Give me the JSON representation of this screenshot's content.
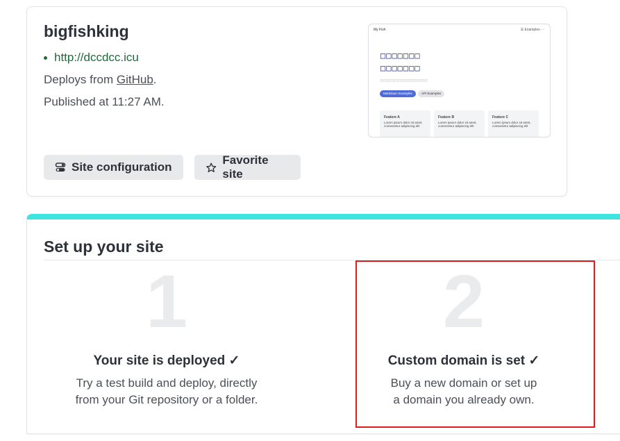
{
  "site": {
    "name": "bigfishking",
    "url": "http://dccdcc.icu",
    "deploys_prefix": "Deploys from ",
    "deploys_link": "GitHub",
    "deploys_suffix": ".",
    "published": "Published at 11:27 AM.",
    "config_button": "Site configuration",
    "favorite_button": "Favorite site"
  },
  "preview": {
    "brand": "My Fish",
    "nav_right": "☰   Examples   ⋯",
    "heading_line1": "□□□□□□□",
    "heading_line2": "□□□□□□□",
    "subtitle": "□□□□□□□□□□□□□□□□□",
    "btn_primary": "Markdown Examples",
    "btn_secondary": "API Examples",
    "features": [
      {
        "title": "Feature A",
        "text": "Lorem ipsum dolor sit amet, consectetur adipiscing elit"
      },
      {
        "title": "Feature B",
        "text": "Lorem ipsum dolor sit amet, consectetur adipiscing elit"
      },
      {
        "title": "Feature C",
        "text": "Lorem ipsum dolor sit amet, consectetur adipiscing elit"
      }
    ]
  },
  "setup": {
    "title": "Set up your site",
    "steps": [
      {
        "number": "1",
        "title": "Your site is deployed ✓",
        "desc_line1": "Try a test build and deploy, directly",
        "desc_line2": "from your Git repository or a folder."
      },
      {
        "number": "2",
        "title": "Custom domain is set ✓",
        "desc_line1": "Buy a new domain or set up",
        "desc_line2": "a domain you already own."
      }
    ]
  },
  "colors": {
    "accent_bar": "#3ee5e0",
    "url_green": "#1f6b3a",
    "highlight_red": "#e01b1b"
  }
}
